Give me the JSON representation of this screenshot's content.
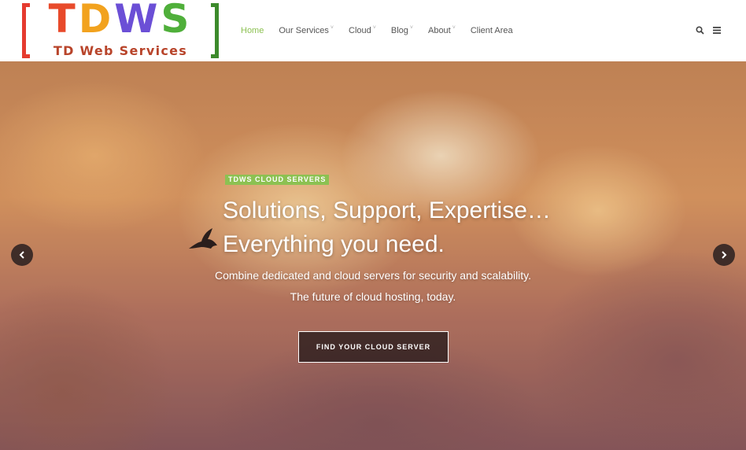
{
  "logo": {
    "top_letters": [
      "T",
      "D",
      "W",
      "S"
    ],
    "bottom_text": "TD Web Services"
  },
  "nav": {
    "items": [
      {
        "label": "Home",
        "active": true,
        "has_dropdown": false
      },
      {
        "label": "Our Services",
        "active": false,
        "has_dropdown": true
      },
      {
        "label": "Cloud",
        "active": false,
        "has_dropdown": true
      },
      {
        "label": "Blog",
        "active": false,
        "has_dropdown": true
      },
      {
        "label": "About",
        "active": false,
        "has_dropdown": true
      },
      {
        "label": "Client Area",
        "active": false,
        "has_dropdown": false
      }
    ],
    "caret": "˅"
  },
  "header_icons": [
    "search-icon",
    "menu-icon"
  ],
  "hero": {
    "tag": "TDWS CLOUD SERVERS",
    "headline_line1": "Solutions, Support, Expertise…",
    "headline_line2": "Everything you need.",
    "subtext_line1": "Combine dedicated and cloud servers for security and scalability.",
    "subtext_line2": "The future of cloud hosting, today.",
    "cta_label": "FIND YOUR CLOUD SERVER"
  },
  "colors": {
    "accent": "#8cc152",
    "nav_text": "#555555",
    "cta_bg": "#2d1e1e"
  }
}
